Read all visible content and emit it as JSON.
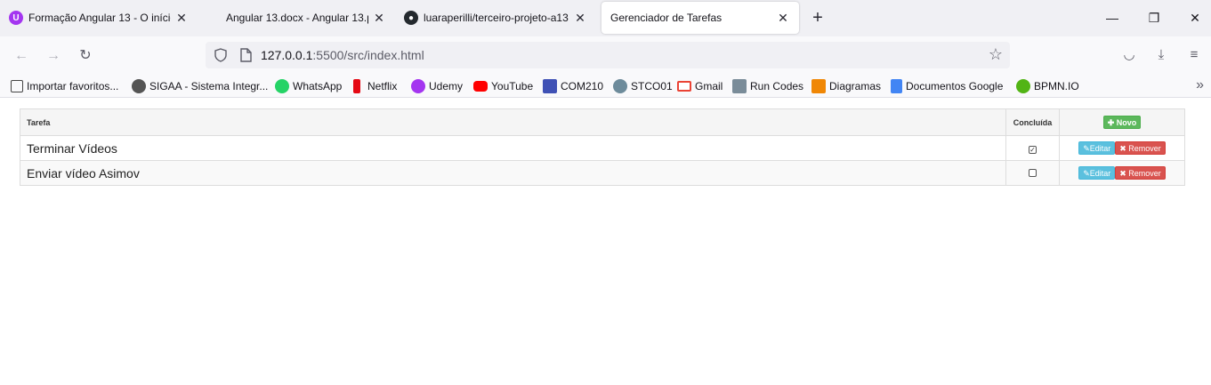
{
  "browser": {
    "tabs": [
      {
        "title": "Formação Angular 13 - O início",
        "icon": "purple-u-icon",
        "active": false
      },
      {
        "title": "Angular 13.docx - Angular 13.p",
        "icon": "document-icon",
        "active": false
      },
      {
        "title": "luaraperilli/terceiro-projeto-a13",
        "icon": "github-icon",
        "active": false
      },
      {
        "title": "Gerenciador de Tarefas",
        "icon": "",
        "active": true
      }
    ],
    "new_tab": "+",
    "window_controls": {
      "minimize": "—",
      "restore": "❐",
      "close": "✕"
    },
    "url": {
      "host": "127.0.0.1",
      "path": ":5500/src/index.html"
    },
    "bookmarks": [
      {
        "label": "Importar favoritos...",
        "icon": "import-icon",
        "color": "#444444"
      },
      {
        "label": "SIGAA - Sistema Integr...",
        "icon": "gear-icon",
        "color": "#555555"
      },
      {
        "label": "WhatsApp",
        "icon": "whatsapp-icon",
        "color": "#25d366"
      },
      {
        "label": "Netflix",
        "icon": "netflix-icon",
        "color": "#e50914"
      },
      {
        "label": "Udemy",
        "icon": "udemy-icon",
        "color": "#a435f0"
      },
      {
        "label": "YouTube",
        "icon": "youtube-icon",
        "color": "#ff0000"
      },
      {
        "label": "COM210",
        "icon": "calendar-icon",
        "color": "#3f51b5"
      },
      {
        "label": "STCO01",
        "icon": "stco-icon",
        "color": "#6d8b9b"
      },
      {
        "label": "Gmail",
        "icon": "gmail-icon",
        "color": "#ea4335"
      },
      {
        "label": "Run Codes",
        "icon": "runcodes-icon",
        "color": "#7a8c99"
      },
      {
        "label": "Diagramas",
        "icon": "diagram-icon",
        "color": "#f08705"
      },
      {
        "label": "Documentos Google",
        "icon": "docs-icon",
        "color": "#4285f4"
      },
      {
        "label": "BPMN.IO",
        "icon": "bpmn-icon",
        "color": "#52b415"
      }
    ]
  },
  "table": {
    "headers": {
      "task": "Tarefa",
      "done": "Concluída"
    },
    "new_button": "Novo",
    "edit_button": "Editar",
    "remove_button": "Remover",
    "rows": [
      {
        "task": "Terminar Vídeos",
        "done": true
      },
      {
        "task": "Enviar vídeo Asimov",
        "done": false
      }
    ]
  },
  "colors": {
    "success": "#5cb85c",
    "info": "#5bc0de",
    "danger": "#d9534f"
  }
}
